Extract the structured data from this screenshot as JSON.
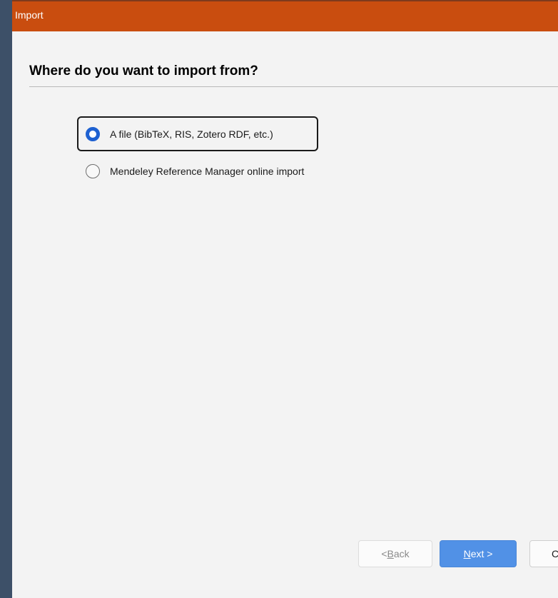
{
  "window": {
    "title": "Import"
  },
  "page": {
    "heading": "Where do you want to import from?"
  },
  "options": [
    {
      "label": "A file (BibTeX, RIS, Zotero RDF, etc.)",
      "selected": true
    },
    {
      "label": "Mendeley Reference Manager online import",
      "selected": false
    }
  ],
  "buttons": {
    "back": {
      "prefix": "< ",
      "mnemonic": "B",
      "rest": "ack",
      "enabled": false
    },
    "next": {
      "mnemonic": "N",
      "rest": "ext >",
      "enabled": true
    },
    "cancel": {
      "label": "Cancel"
    }
  },
  "colors": {
    "titlebar": "#c94d0f",
    "accent": "#1e61d1",
    "primary_button": "#5191e6"
  }
}
